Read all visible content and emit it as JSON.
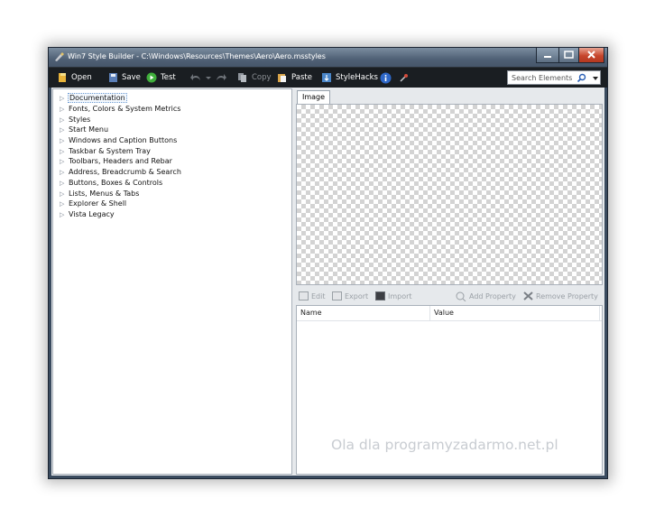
{
  "window": {
    "title": "Win7 Style Builder - C:\\Windows\\Resources\\Themes\\Aero\\Aero.msstyles",
    "controls": [
      "minimize-icon",
      "maximize-icon",
      "close-icon"
    ]
  },
  "toolbar": {
    "open": "Open",
    "save": "Save",
    "test": "Test",
    "copy": "Copy",
    "paste": "Paste",
    "stylehacks": "StyleHacks",
    "search_placeholder": "Search Elements"
  },
  "tree": {
    "items": [
      "Documentation",
      "Fonts, Colors & System Metrics",
      "Styles",
      "Start Menu",
      "Windows and Caption Buttons",
      "Taskbar & System Tray",
      "Toolbars, Headers and Rebar",
      "Address, Breadcrumb & Search",
      "Buttons, Boxes & Controls",
      "Lists, Menus & Tabs",
      "Explorer & Shell",
      "Vista Legacy"
    ],
    "selected_index": 0
  },
  "image_panel": {
    "tab_label": "Image"
  },
  "image_buttons": {
    "edit": "Edit",
    "export": "Export",
    "import": "Import",
    "add_property": "Add Property",
    "remove_property": "Remove Property"
  },
  "properties": {
    "columns": [
      "Name",
      "Value"
    ]
  },
  "watermark": "Ola dla programyzadarmo.net.pl",
  "colors": {
    "titlebar": "#4f6075",
    "toolbar": "#1a1e22",
    "close": "#c7462c",
    "checker": "#d3d3d3"
  }
}
